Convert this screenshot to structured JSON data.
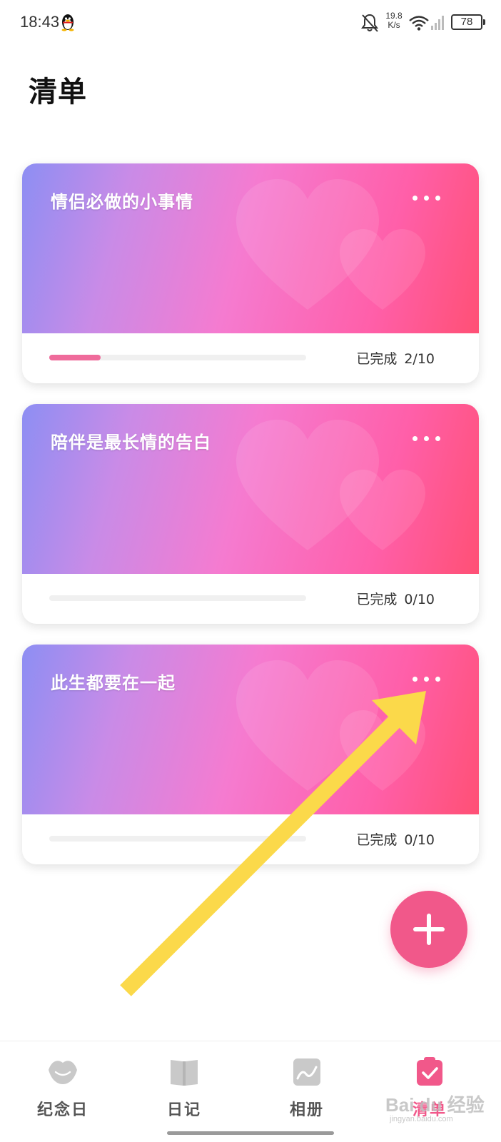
{
  "status_bar": {
    "time": "18:43",
    "net_speed_value": "19.8",
    "net_speed_unit": "K/s",
    "battery": "78"
  },
  "page": {
    "title": "清单"
  },
  "lists": [
    {
      "title": "情侣必做的小事情",
      "status_label": "已完成",
      "count": "2/10",
      "progress": 0.2
    },
    {
      "title": "陪伴是最长情的告白",
      "status_label": "已完成",
      "count": "0/10",
      "progress": 0.0
    },
    {
      "title": "此生都要在一起",
      "status_label": "已完成",
      "count": "0/10",
      "progress": 0.0
    }
  ],
  "fab": {
    "icon": "plus-icon"
  },
  "bottom_nav": {
    "items": [
      {
        "label": "纪念日",
        "icon": "lips-icon",
        "active": false
      },
      {
        "label": "日记",
        "icon": "book-icon",
        "active": false
      },
      {
        "label": "相册",
        "icon": "photo-icon",
        "active": false
      },
      {
        "label": "清单",
        "icon": "checklist-icon",
        "active": true
      }
    ]
  },
  "watermark": {
    "main": "Bai du 经验",
    "sub": "jingyan.baidu.com"
  },
  "colors": {
    "accent": "#f1588a",
    "progress_fill": "#ef6b9b",
    "annotation_arrow": "#fbd94a"
  }
}
